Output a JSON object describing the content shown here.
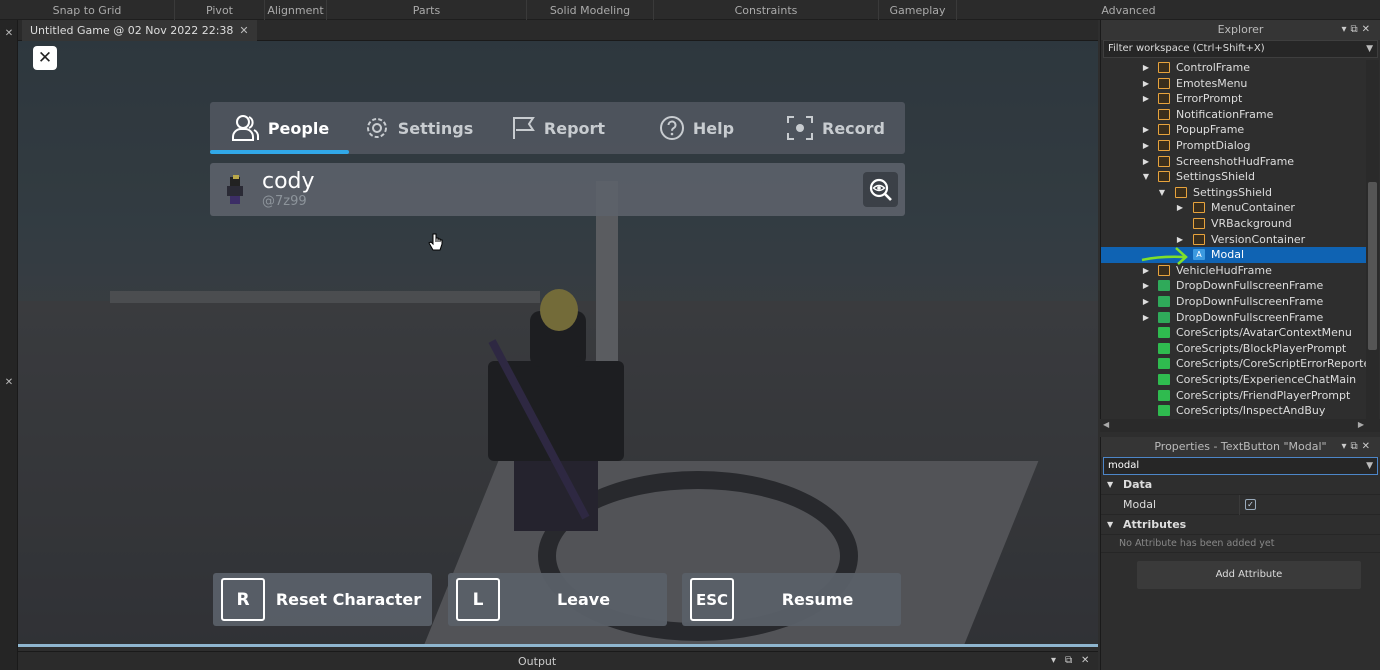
{
  "ribbon": {
    "groups": [
      "Snap to Grid",
      "Pivot",
      "Alignment",
      "Parts",
      "Solid Modeling",
      "Constraints",
      "Gameplay",
      "Advanced"
    ]
  },
  "doc_tab": {
    "title": "Untitled Game @ 02 Nov 2022 22:38",
    "close": "✕"
  },
  "game_menu": {
    "close_symbol": "✕",
    "tabs": [
      {
        "label": "People",
        "icon": "people-icon",
        "active": true
      },
      {
        "label": "Settings",
        "icon": "gear-icon",
        "active": false
      },
      {
        "label": "Report",
        "icon": "flag-icon",
        "active": false
      },
      {
        "label": "Help",
        "icon": "question-icon",
        "active": false
      },
      {
        "label": "Record",
        "icon": "record-icon",
        "active": false
      }
    ],
    "player": {
      "display_name": "cody",
      "username": "@7z99"
    },
    "buttons": [
      {
        "key": "R",
        "label": "Reset Character"
      },
      {
        "key": "L",
        "label": "Leave"
      },
      {
        "key": "ESC",
        "label": "Resume"
      }
    ],
    "accent_color": "#31a8e8"
  },
  "output": {
    "title": "Output"
  },
  "explorer": {
    "title": "Explorer",
    "filter_placeholder": "Filter workspace (Ctrl+Shift+X)",
    "items": [
      {
        "label": "ControlFrame",
        "icon": "frame-icon",
        "depth": 0,
        "expandable": true
      },
      {
        "label": "EmotesMenu",
        "icon": "frame-icon",
        "depth": 0,
        "expandable": true
      },
      {
        "label": "ErrorPrompt",
        "icon": "frame-icon",
        "depth": 0,
        "expandable": true
      },
      {
        "label": "NotificationFrame",
        "icon": "frame-icon",
        "depth": 0,
        "expandable": false
      },
      {
        "label": "PopupFrame",
        "icon": "frame-icon",
        "depth": 0,
        "expandable": true
      },
      {
        "label": "PromptDialog",
        "icon": "frame-icon",
        "depth": 0,
        "expandable": true
      },
      {
        "label": "ScreenshotHudFrame",
        "icon": "frame-icon",
        "depth": 0,
        "expandable": true
      },
      {
        "label": "SettingsShield",
        "icon": "frame-icon",
        "depth": 0,
        "expanded": true
      },
      {
        "label": "SettingsShield",
        "icon": "frame-icon",
        "depth": 1,
        "expanded": true
      },
      {
        "label": "MenuContainer",
        "icon": "frame-icon",
        "depth": 2,
        "expandable": true
      },
      {
        "label": "VRBackground",
        "icon": "frame-icon",
        "depth": 2,
        "expandable": false
      },
      {
        "label": "VersionContainer",
        "icon": "frame-icon",
        "depth": 2,
        "expandable": true
      },
      {
        "label": "Modal",
        "icon": "textbutton-icon",
        "depth": 2,
        "expandable": false,
        "selected": true
      },
      {
        "label": "VehicleHudFrame",
        "icon": "frame-icon",
        "depth": 0,
        "expandable": true
      },
      {
        "label": "DropDownFullscreenFrame",
        "icon": "image-icon",
        "depth": 0,
        "expandable": true
      },
      {
        "label": "DropDownFullscreenFrame",
        "icon": "image-icon",
        "depth": 0,
        "expandable": true
      },
      {
        "label": "DropDownFullscreenFrame",
        "icon": "image-icon",
        "depth": 0,
        "expandable": true
      },
      {
        "label": "CoreScripts/AvatarContextMenu",
        "icon": "script-icon",
        "depth": 0,
        "expandable": false
      },
      {
        "label": "CoreScripts/BlockPlayerPrompt",
        "icon": "script-icon",
        "depth": 0,
        "expandable": false
      },
      {
        "label": "CoreScripts/CoreScriptErrorReporter",
        "icon": "script-icon",
        "depth": 0,
        "expandable": false
      },
      {
        "label": "CoreScripts/ExperienceChatMain",
        "icon": "script-icon",
        "depth": 0,
        "expandable": false
      },
      {
        "label": "CoreScripts/FriendPlayerPrompt",
        "icon": "script-icon",
        "depth": 0,
        "expandable": false
      },
      {
        "label": "CoreScripts/InspectAndBuy",
        "icon": "script-icon",
        "depth": 0,
        "expandable": false
      }
    ]
  },
  "properties": {
    "title": "Properties - TextButton \"Modal\"",
    "search_value": "modal",
    "sections": [
      {
        "label": "Data"
      },
      {
        "label": "Attributes"
      }
    ],
    "modal_prop": {
      "name": "Modal",
      "checked": true,
      "check_glyph": "✓"
    },
    "no_attributes_text": "No Attribute has been added yet",
    "add_attribute_label": "Add Attribute"
  }
}
